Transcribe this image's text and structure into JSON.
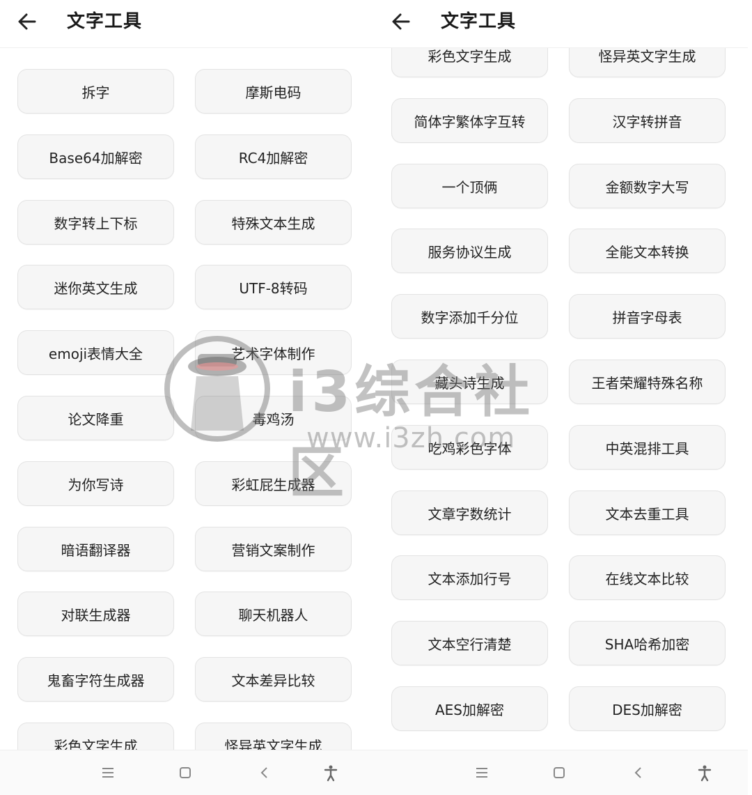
{
  "left": {
    "title": "文字工具",
    "items": [
      "拆字",
      "摩斯电码",
      "Base64加解密",
      "RC4加解密",
      "数字转上下标",
      "特殊文本生成",
      "迷你英文生成",
      "UTF-8转码",
      "emoji表情大全",
      "艺术字体制作",
      "论文降重",
      "毒鸡汤",
      "为你写诗",
      "彩虹屁生成器",
      "暗语翻译器",
      "营销文案制作",
      "对联生成器",
      "聊天机器人",
      "鬼畜字符生成器",
      "文本差异比较",
      "彩色文字生成",
      "怪异英文字生成"
    ]
  },
  "right": {
    "title": "文字工具",
    "items": [
      "彩色文字生成",
      "怪异英文字生成",
      "简体字繁体字互转",
      "汉字转拼音",
      "一个顶俩",
      "金额数字大写",
      "服务协议生成",
      "全能文本转换",
      "数字添加千分位",
      "拼音字母表",
      "藏头诗生成",
      "王者荣耀特殊名称",
      "吃鸡彩色字体",
      "中英混排工具",
      "文章字数统计",
      "文本去重工具",
      "文本添加行号",
      "在线文本比较",
      "文本空行清楚",
      "SHA哈希加密",
      "AES加解密",
      "DES加解密"
    ]
  },
  "watermark": {
    "text": "i3综合社区",
    "url": "www.i3zh.com"
  },
  "icons": {
    "back": "arrow-left-icon",
    "nav": [
      "menu-icon",
      "home-square-icon",
      "back-chevron-icon",
      "accessibility-icon"
    ]
  }
}
